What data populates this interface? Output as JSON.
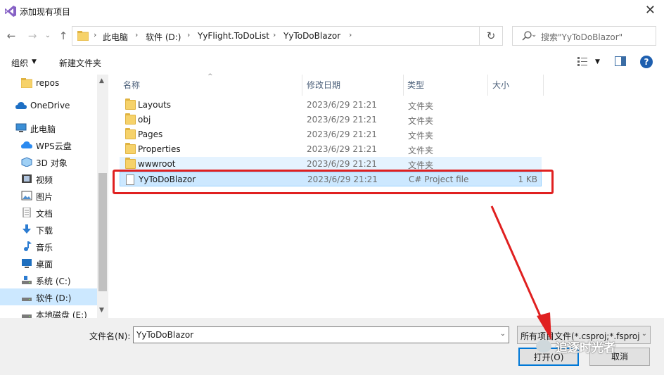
{
  "window": {
    "title": "添加现有项目",
    "close_icon": "close-icon"
  },
  "address": {
    "crumbs": [
      "此电脑",
      "软件 (D:)",
      "YyFlight.ToDoList",
      "YyToDoBlazor"
    ],
    "search_placeholder": "搜索\"YyToDoBlazor\""
  },
  "toolbar": {
    "organize_label": "组织",
    "new_folder_label": "新建文件夹"
  },
  "sidebar": {
    "items": [
      {
        "label": "repos",
        "icon": "folder-icon"
      },
      {
        "label": "OneDrive",
        "icon": "cloud-icon"
      },
      {
        "label": "此电脑",
        "icon": "computer-icon"
      },
      {
        "label": "WPS云盘",
        "icon": "wps-cloud-icon"
      },
      {
        "label": "3D 对象",
        "icon": "3d-objects-icon"
      },
      {
        "label": "视频",
        "icon": "video-icon"
      },
      {
        "label": "图片",
        "icon": "pictures-icon"
      },
      {
        "label": "文档",
        "icon": "documents-icon"
      },
      {
        "label": "下载",
        "icon": "download-icon"
      },
      {
        "label": "音乐",
        "icon": "music-icon"
      },
      {
        "label": "桌面",
        "icon": "desktop-icon"
      },
      {
        "label": "系统 (C:)",
        "icon": "drive-icon"
      },
      {
        "label": "软件 (D:)",
        "icon": "drive-icon",
        "selected": true
      },
      {
        "label": "本地磁盘 (E:)",
        "icon": "drive-icon"
      }
    ]
  },
  "list": {
    "columns": {
      "name": "名称",
      "modified": "修改日期",
      "type": "类型",
      "size": "大小"
    },
    "rows": [
      {
        "name": "Layouts",
        "modified": "2023/6/29 21:21",
        "type": "文件夹",
        "size": ""
      },
      {
        "name": "obj",
        "modified": "2023/6/29 21:21",
        "type": "文件夹",
        "size": ""
      },
      {
        "name": "Pages",
        "modified": "2023/6/29 21:21",
        "type": "文件夹",
        "size": ""
      },
      {
        "name": "Properties",
        "modified": "2023/6/29 21:21",
        "type": "文件夹",
        "size": ""
      },
      {
        "name": "wwwroot",
        "modified": "2023/6/29 21:21",
        "type": "文件夹",
        "size": ""
      },
      {
        "name": "YyToDoBlazor",
        "modified": "2023/6/29 21:21",
        "type": "C# Project file",
        "size": "1 KB",
        "selected": true
      }
    ]
  },
  "footer": {
    "filename_label": "文件名(N):",
    "filename_value": "YyToDoBlazor",
    "filter_value": "所有项目文件(*.csproj;*.fsproj",
    "open_label": "打开(O)",
    "cancel_label": "取消"
  },
  "watermark": {
    "text": "追逐时光者"
  },
  "colors": {
    "annotation": "#e02020",
    "selection": "#cce8ff",
    "accent": "#0078d7"
  }
}
